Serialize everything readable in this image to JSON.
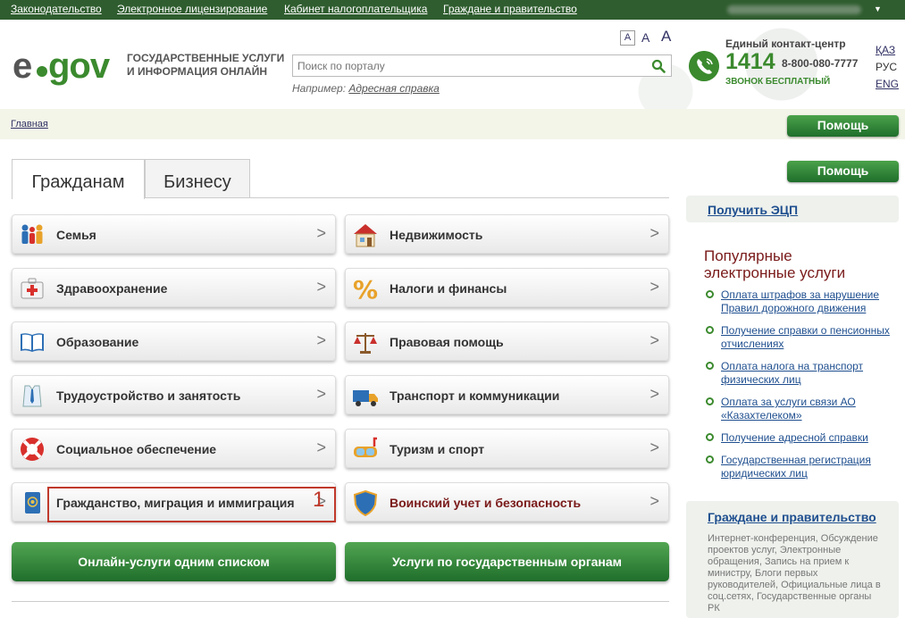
{
  "topbar": {
    "links": [
      "Законодательство",
      "Электронное лицензирование",
      "Кабинет налогоплательщика",
      "Граждане и правительство"
    ]
  },
  "header": {
    "logo_left": "e",
    "logo_right": "gov",
    "tagline": "ГОСУДАРСТВЕННЫЕ УСЛУГИ И ИНФОРМАЦИЯ ОНЛАЙН",
    "font_sizes": [
      "A",
      "A",
      "A"
    ],
    "search_placeholder": "Поиск по порталу",
    "example_prefix": "Например:",
    "example_link": "Адресная справка",
    "contact_title": "Единый контакт-центр",
    "phone_short": "1414",
    "phone_long": "8-800-080-7777",
    "phone_free": "ЗВОНОК БЕСПЛАТНЫЙ",
    "languages": [
      "ҚАЗ",
      "РУС",
      "ENG"
    ]
  },
  "breadcrumb": {
    "home": "Главная"
  },
  "help_label": "Помощь",
  "tabs": [
    "Гражданам",
    "Бизнесу"
  ],
  "categories": [
    {
      "label": "Семья",
      "icon": "family-icon"
    },
    {
      "label": "Недвижимость",
      "icon": "house-icon"
    },
    {
      "label": "Здравоохранение",
      "icon": "medical-kit-icon"
    },
    {
      "label": "Налоги и финансы",
      "icon": "percent-icon"
    },
    {
      "label": "Образование",
      "icon": "book-icon"
    },
    {
      "label": "Правовая помощь",
      "icon": "scales-icon"
    },
    {
      "label": "Трудоустройство и занятость",
      "icon": "shirt-tie-icon"
    },
    {
      "label": "Транспорт и коммуникации",
      "icon": "truck-icon"
    },
    {
      "label": "Социальное обеспечение",
      "icon": "lifebuoy-icon"
    },
    {
      "label": "Туризм и спорт",
      "icon": "diving-mask-icon"
    },
    {
      "label": "Гражданство, миграция и иммиграция",
      "icon": "passport-icon"
    },
    {
      "label": "Воинский учет и безопасность",
      "icon": "shield-icon"
    }
  ],
  "chevron": ">",
  "highlight_number": "1",
  "big_buttons": [
    "Онлайн-услуги одним списком",
    "Услуги по государственным органам"
  ],
  "sidebar": {
    "ecp_link": "Получить ЭЦП",
    "popular_title": "Популярные электронные услуги",
    "popular": [
      "Оплата штрафов за нарушение Правил дорожного движения",
      "Получение справки о пенсионных отчислениях",
      "Оплата налога на транспорт физических лиц",
      "Оплата за услуги связи АО «Казахтелеком»",
      "Получение адресной справки",
      "Государственная регистрация юридических лиц"
    ],
    "gov_title": "Граждане и правительство",
    "gov_text": "Интернет-конференция, Обсуждение проектов услуг, Электронные обращения, Запись на прием к министру, Блоги первых руководителей, Официальные лица в соц.сетях, Государственные органы РК"
  },
  "colors": {
    "brand_green": "#3b8a2e",
    "topbar": "#2f5d2f",
    "link_blue": "#1f4f8f",
    "accent_red": "#7a1a1a"
  }
}
